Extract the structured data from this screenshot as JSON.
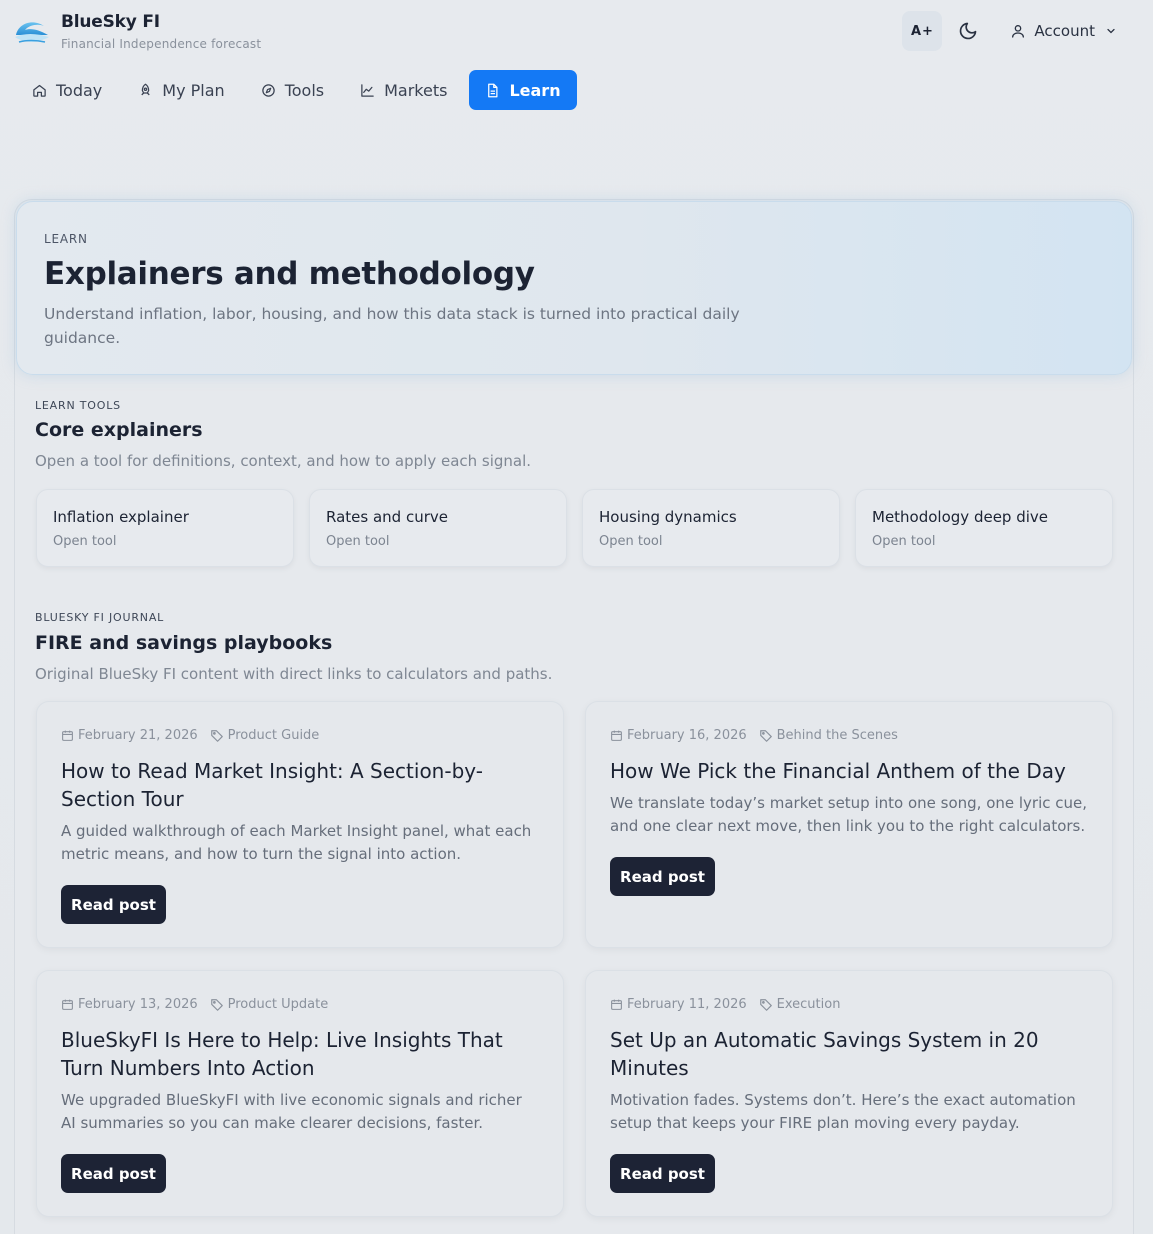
{
  "brand": {
    "name": "BlueSky FI",
    "subtitle": "Financial Independence forecast"
  },
  "header": {
    "text_size_label": "A+",
    "theme_icon": "moon-icon",
    "account_label": "Account"
  },
  "nav": {
    "items": [
      {
        "label": "Today",
        "icon": "home-icon",
        "active": false
      },
      {
        "label": "My Plan",
        "icon": "rocket-icon",
        "active": false
      },
      {
        "label": "Tools",
        "icon": "compass-icon",
        "active": false
      },
      {
        "label": "Markets",
        "icon": "chart-icon",
        "active": false
      },
      {
        "label": "Learn",
        "icon": "document-icon",
        "active": true
      }
    ]
  },
  "hero": {
    "eyebrow": "LEARN",
    "title": "Explainers and methodology",
    "description": "Understand inflation, labor, housing, and how this data stack is turned into practical daily guidance."
  },
  "learn_tools": {
    "eyebrow": "LEARN TOOLS",
    "title": "Core explainers",
    "description": "Open a tool for definitions, context, and how to apply each signal.",
    "cards": [
      {
        "name": "Inflation explainer",
        "action": "Open tool"
      },
      {
        "name": "Rates and curve",
        "action": "Open tool"
      },
      {
        "name": "Housing dynamics",
        "action": "Open tool"
      },
      {
        "name": "Methodology deep dive",
        "action": "Open tool"
      }
    ]
  },
  "journal": {
    "eyebrow": "BLUESKY FI JOURNAL",
    "title": "FIRE and savings playbooks",
    "description": "Original BlueSky FI content with direct links to calculators and paths.",
    "posts": [
      {
        "date": "February 21, 2026",
        "tag": "Product Guide",
        "title": "How to Read Market Insight: A Section-by-Section Tour",
        "excerpt": "A guided walkthrough of each Market Insight panel, what each metric means, and how to turn the signal into action.",
        "button": "Read post"
      },
      {
        "date": "February 16, 2026",
        "tag": "Behind the Scenes",
        "title": "How We Pick the Financial Anthem of the Day",
        "excerpt": "We translate today’s market setup into one song, one lyric cue, and one clear next move, then link you to the right calculators.",
        "button": "Read post"
      },
      {
        "date": "February 13, 2026",
        "tag": "Product Update",
        "title": "BlueSkyFI Is Here to Help: Live Insights That Turn Numbers Into Action",
        "excerpt": "We upgraded BlueSkyFI with live economic signals and richer AI summaries so you can make clearer decisions, faster.",
        "button": "Read post"
      },
      {
        "date": "February 11, 2026",
        "tag": "Execution",
        "title": "Set Up an Automatic Savings System in 20 Minutes",
        "excerpt": "Motivation fades. Systems don’t. Here’s the exact automation setup that keeps your FIRE plan moving every payday.",
        "button": "Read post"
      }
    ]
  },
  "colors": {
    "accent": "#1479f5",
    "dark_button": "#1d2335",
    "text_primary": "#1c2333",
    "text_muted": "#7f8793"
  }
}
